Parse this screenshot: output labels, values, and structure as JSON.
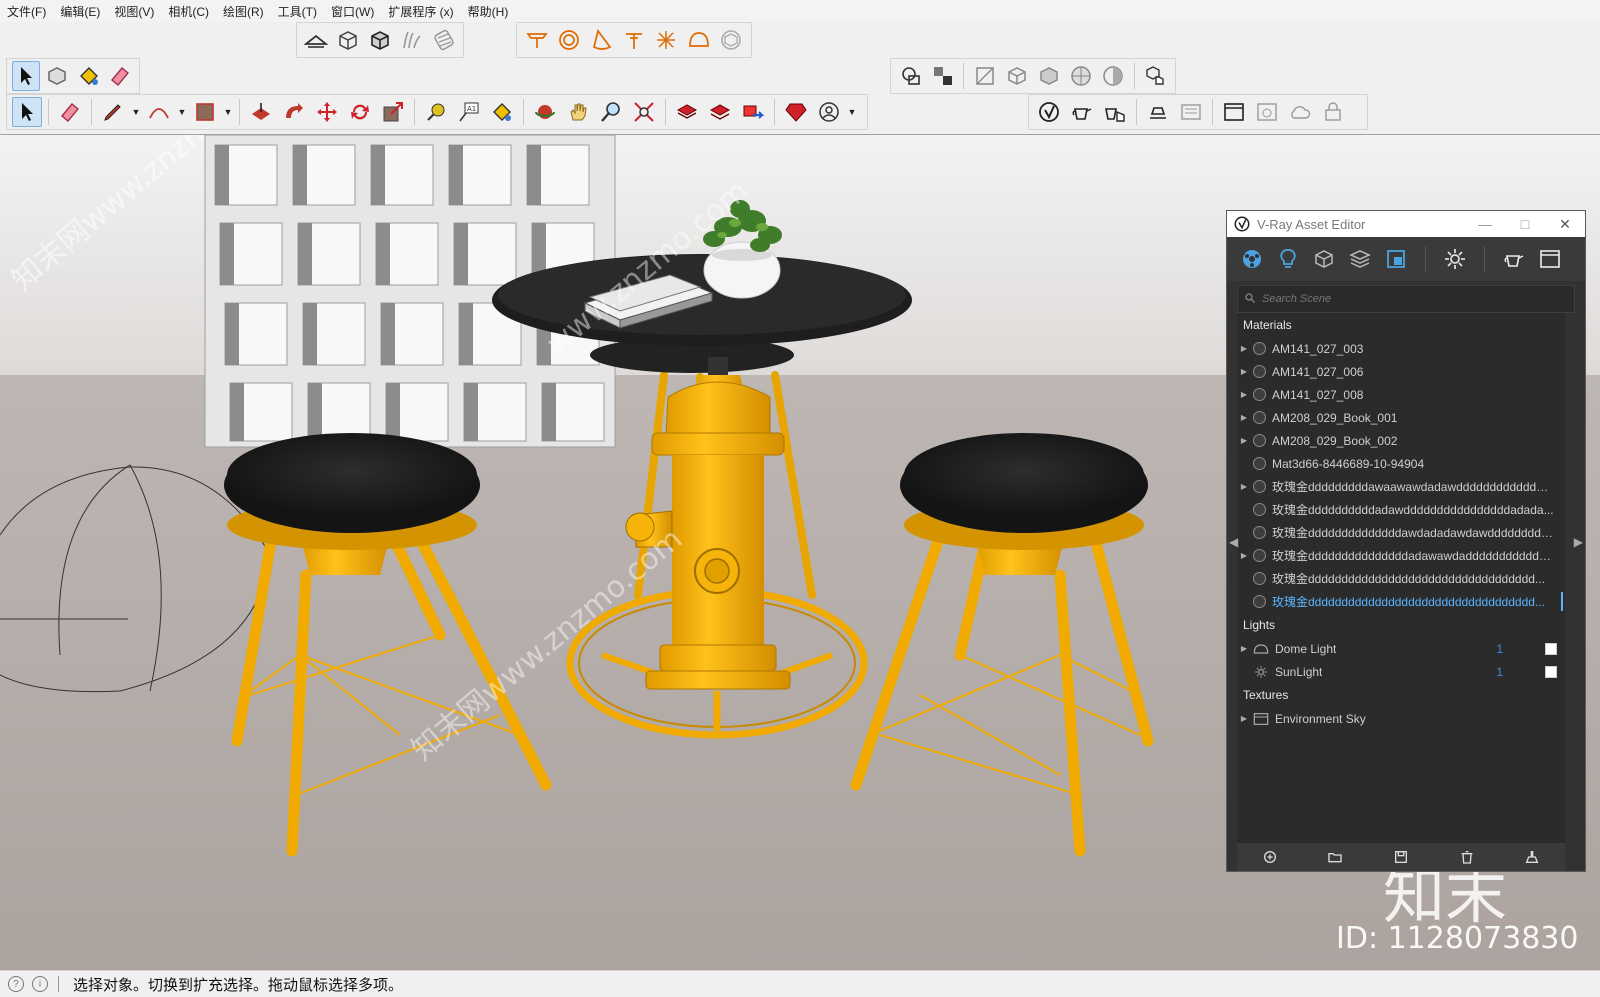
{
  "menu": [
    "文件(F)",
    "编辑(E)",
    "视图(V)",
    "相机(C)",
    "绘图(R)",
    "工具(T)",
    "窗口(W)",
    "扩展程序 (x)",
    "帮助(H)"
  ],
  "toolbar": {
    "icons_row1a": [
      "section-plane-icon",
      "box-icon",
      "solid-box-icon",
      "grass-icon",
      "striped-cylinder-icon"
    ],
    "icons_row1b": [
      "table-top-icon",
      "ring-icon",
      "cone-icon",
      "pin-icon",
      "sparkle-icon",
      "dome-icon",
      "sphere-icon"
    ],
    "icons_row2a": [
      "select-arrow-icon",
      "component-icon",
      "paint-bucket-icon",
      "eraser-icon"
    ],
    "icons_row2b": [
      "overlap-icon",
      "swap-icon",
      "view-face-icon",
      "cube-outline-icon",
      "cube-solid-icon",
      "grid-sphere-icon",
      "half-sphere-icon",
      "hand-cube-icon"
    ],
    "icons_row3a": [
      "select-arrow-icon",
      "eraser-icon",
      "pencil-icon",
      "arc-icon",
      "rectangle-icon",
      "push-pull-icon",
      "follow-icon",
      "move-icon",
      "rotate-icon",
      "scale-icon",
      "tape-icon",
      "text-icon",
      "paint-icon",
      "orbit-icon",
      "pan-icon",
      "zoom-icon",
      "zoom-extents-icon",
      "warehouse-icon",
      "gem-icon",
      "gem-share-icon",
      "ruby-icon",
      "profile-icon"
    ],
    "icons_row3b": [
      "vray-logo-icon",
      "render-teapot-icon",
      "interactive-teapot-icon",
      "bake-icon",
      "frame-buffer-icon",
      "vfb-window-icon",
      "render-region-icon",
      "cloud-render-icon",
      "lock-icon"
    ]
  },
  "vray_panel": {
    "title": "V-Ray Asset Editor",
    "minimize": "—",
    "maximize": "□",
    "close": "✕",
    "search_placeholder": "Search Scene",
    "sections": {
      "materials": "Materials",
      "lights": "Lights",
      "textures": "Textures"
    },
    "materials": [
      {
        "name": "AM141_027_003",
        "expandable": true
      },
      {
        "name": "AM141_027_006",
        "expandable": true
      },
      {
        "name": "AM141_027_008",
        "expandable": true
      },
      {
        "name": "AM208_029_Book_001",
        "expandable": true
      },
      {
        "name": "AM208_029_Book_002",
        "expandable": true
      },
      {
        "name": "Mat3d66-8446689-10-94904",
        "expandable": false
      },
      {
        "name": "玫瑰金dddddddddawaawawdadawdddddddddddddd...",
        "expandable": true
      },
      {
        "name": "玫瑰金ddddddddddadawddddddddddddddddadada...",
        "expandable": false
      },
      {
        "name": "玫瑰金ddddddddddddddawdadadawdawddddddddd...",
        "expandable": false
      },
      {
        "name": "玫瑰金dddddddddddddddadawawdadddddddddddd...",
        "expandable": true
      },
      {
        "name": "玫瑰金dddddddddddddddddddddddddddddddddd...",
        "expandable": false
      },
      {
        "name": "玫瑰金dddddddddddddddddddddddddddddddddd...",
        "expandable": false,
        "selected": true
      }
    ],
    "lights": [
      {
        "name": "Dome Light",
        "count": "1",
        "enabled": true
      },
      {
        "name": "SunLight",
        "count": "1",
        "enabled": true
      }
    ],
    "textures": [
      {
        "name": "Environment Sky"
      }
    ]
  },
  "statusbar": {
    "text": "选择对象。切换到扩充选择。拖动鼠标选择多项。"
  },
  "watermark": {
    "logo_text": "知末",
    "id_text": "ID: 1128073830",
    "diagonal_texts": [
      "知末网www.znzmo.com",
      "www.znzmo.com",
      "知末网www.znzmo.com"
    ]
  },
  "colors": {
    "yellow": "#ffb800",
    "yellow_dark": "#c98a00",
    "seat_black": "#1e1e1e",
    "floor": "#b3aba7",
    "accent_blue": "#5ab4ff"
  }
}
